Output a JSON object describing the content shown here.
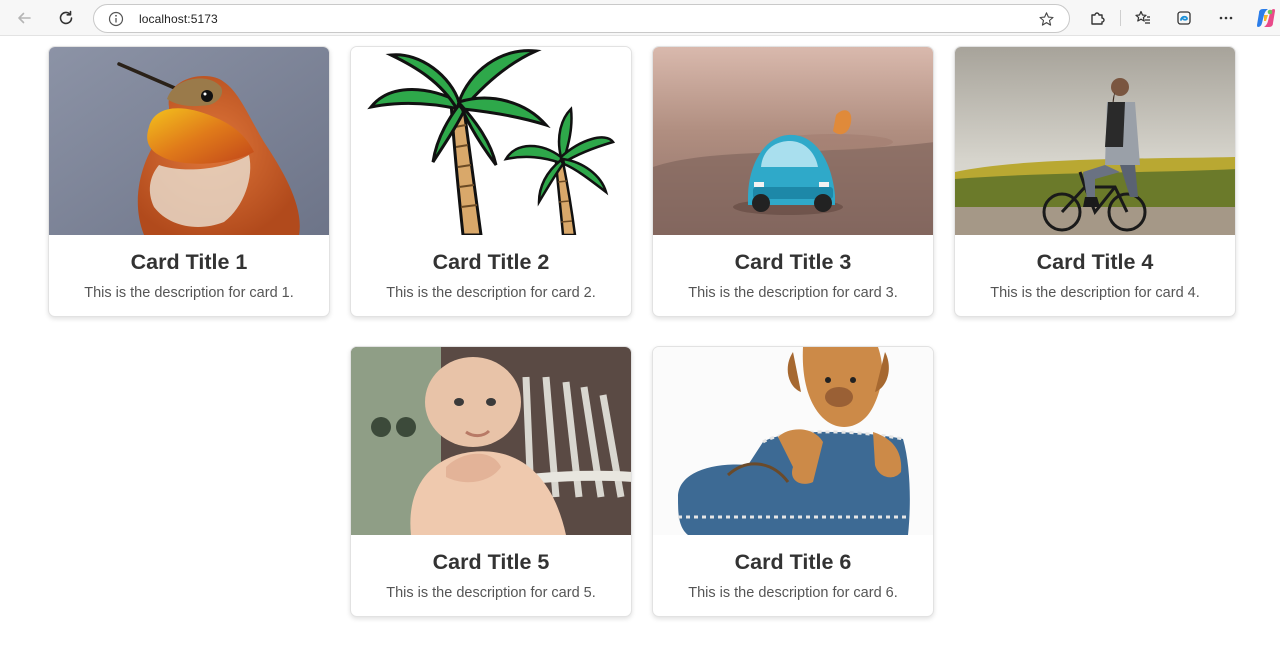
{
  "browser": {
    "url": "localhost:5173",
    "icons": [
      "back-icon",
      "refresh-icon",
      "info-icon",
      "star-icon",
      "extensions-icon",
      "favorites-icon",
      "collections-icon",
      "more-icon",
      "copilot-icon"
    ]
  },
  "cards": [
    {
      "title": "Card Title 1",
      "description": "This is the description for card 1.",
      "image": "hummingbird-photo"
    },
    {
      "title": "Card Title 2",
      "description": "This is the description for card 2.",
      "image": "palm-trees-illustration"
    },
    {
      "title": "Card Title 3",
      "description": "This is the description for card 3.",
      "image": "toy-car-photo"
    },
    {
      "title": "Card Title 4",
      "description": "This is the description for card 4.",
      "image": "man-on-bicycle-photo"
    },
    {
      "title": "Card Title 5",
      "description": "This is the description for card 5.",
      "image": "baby-photo"
    },
    {
      "title": "Card Title 6",
      "description": "This is the description for card 6.",
      "image": "puppy-in-boot-photo"
    }
  ]
}
